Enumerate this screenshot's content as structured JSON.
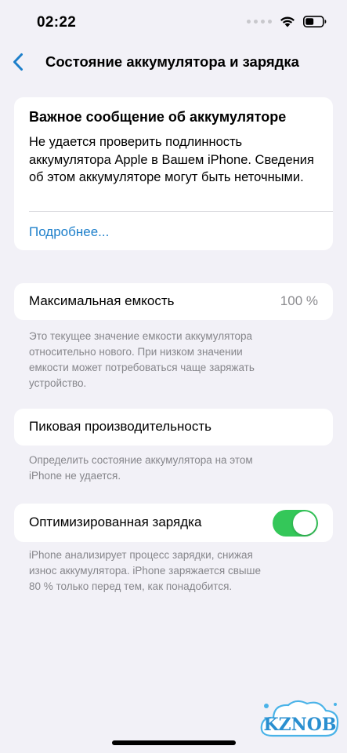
{
  "status_bar": {
    "time": "02:22",
    "icons": [
      "signal-dots-icon",
      "wifi-icon",
      "battery-icon"
    ]
  },
  "nav": {
    "back_icon": "chevron-left-icon",
    "title": "Состояние аккумулятора и зарядка"
  },
  "alert": {
    "title": "Важное сообщение об аккумуляторе",
    "text": "Не удается проверить подлинность аккумулятора Apple в Вашем iPhone. Сведения об этом аккумуляторе могут быть неточными.",
    "link": "Подробнее..."
  },
  "max_capacity": {
    "label": "Максимальная емкость",
    "value": "100 %",
    "footnote": "Это текущее значение емкости аккумулятора\nотносительно нового. При низком значении\nемкости может потребоваться чаще заряжать\nустройство."
  },
  "peak_performance": {
    "label": "Пиковая производительность",
    "footnote": "Определить состояние аккумулятора на этом\niPhone не удается."
  },
  "optimized_charging": {
    "label": "Оптимизированная зарядка",
    "enabled": true,
    "footnote": "iPhone анализирует процесс зарядки, снижая\nизнос аккумулятора. iPhone заряжается свыше\n80 % только перед тем, как понадобится."
  },
  "watermark": {
    "text": "KZNOB"
  },
  "colors": {
    "background": "#f2f1f7",
    "card": "#ffffff",
    "link": "#1d7fca",
    "toggle_on": "#34c759",
    "secondary_text": "#86868b"
  }
}
